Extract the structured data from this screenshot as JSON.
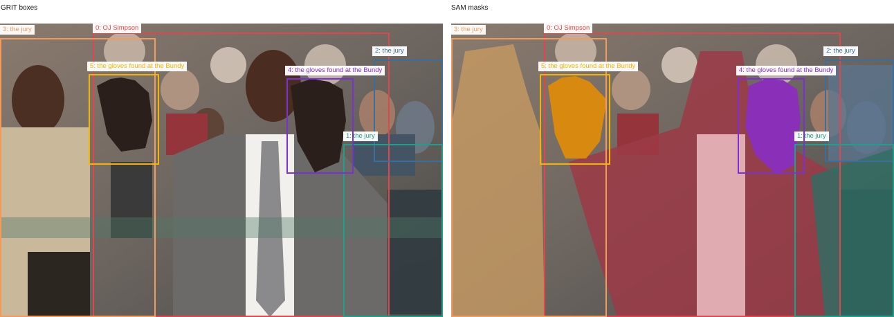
{
  "panels": {
    "left_title": "GRIT boxes",
    "right_title": "SAM masks"
  },
  "detections": {
    "jury0": {
      "label": "0: OJ Simpson",
      "color": "#e0474c"
    },
    "jury1": {
      "label": "1: the jury",
      "color": "#1f9e89"
    },
    "jury2": {
      "label": "2: the jury",
      "color": "#3a6e9c"
    },
    "jury3": {
      "label": "3: the jury",
      "color": "#f29b5b"
    },
    "gloves4": {
      "label": "4: the gloves found at the Bundy",
      "color": "#7b2fd6"
    },
    "gloves5": {
      "label": "5: the gloves found at the Bundy",
      "color": "#f4b400"
    }
  }
}
